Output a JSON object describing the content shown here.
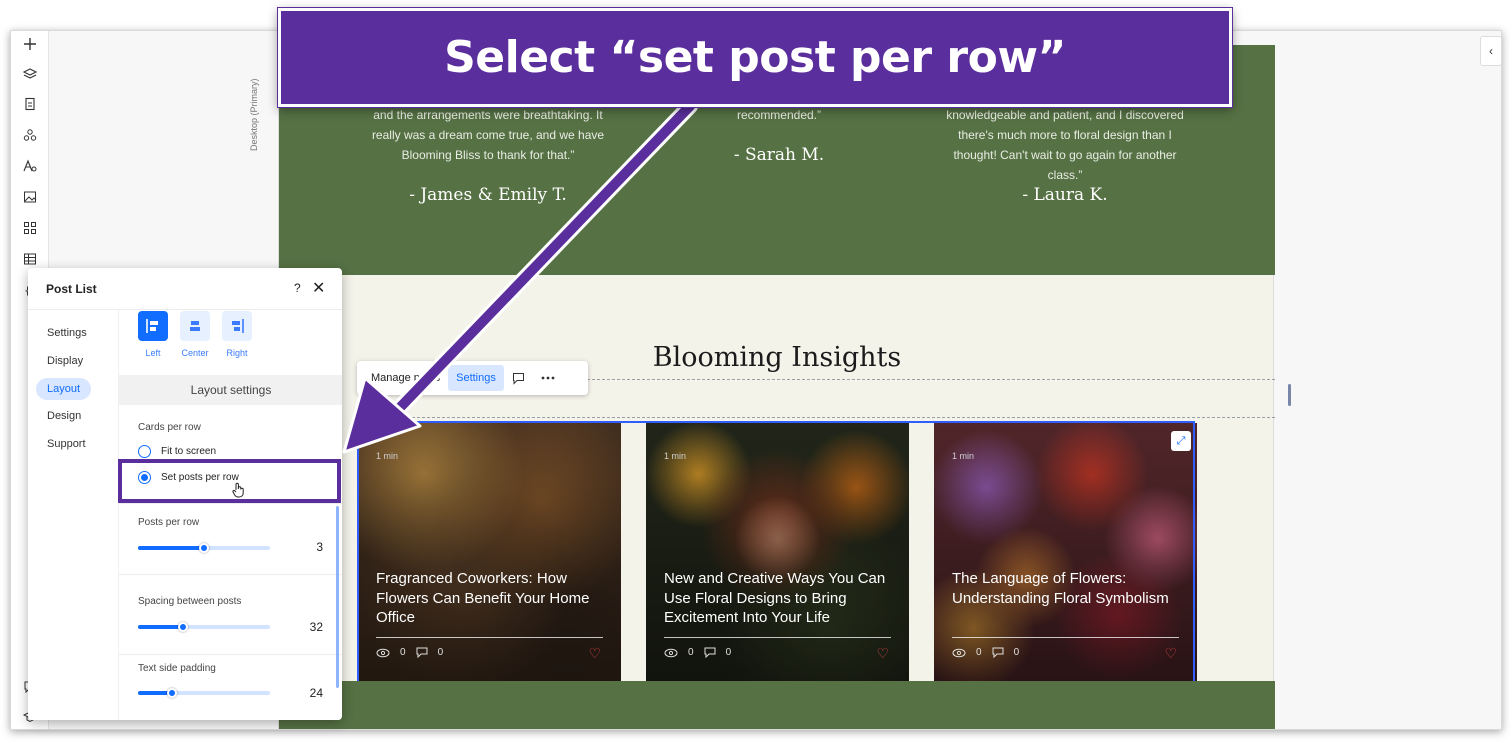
{
  "callout": {
    "text": "Select “set post per row”"
  },
  "canvas": {
    "desktop_label": "Desktop (Primary)",
    "testimonials": [
      {
        "text": "and the arrangements were breathtaking. It really was a dream come true, and we have Blooming Bliss to thank for that.”",
        "author": "- James & Emily T."
      },
      {
        "text": "recommended.”",
        "author": "- Sarah M."
      },
      {
        "text": "knowledgeable and patient, and I discovered there's much more to floral design than I thought! Can't wait to go again for another class.”",
        "author": "- Laura K."
      }
    ],
    "section_title": "Blooming Insights"
  },
  "element_toolbar": {
    "manage_label": "Manage posts",
    "settings_label": "Settings"
  },
  "posts": [
    {
      "read_time": "1 min",
      "title": "Fragranced Coworkers: How Flowers Can Benefit Your Home Office",
      "views": "0",
      "comments": "0"
    },
    {
      "read_time": "1 min",
      "title": "New and Creative Ways You Can Use Floral Designs to Bring Excitement Into Your Life",
      "views": "0",
      "comments": "0"
    },
    {
      "read_time": "1 min",
      "title": "The Language of Flowers: Understanding Floral Symbolism",
      "views": "0",
      "comments": "0"
    }
  ],
  "panel": {
    "title": "Post List",
    "help": "?",
    "nav": [
      "Settings",
      "Display",
      "Layout",
      "Design",
      "Support"
    ],
    "active_nav": "Layout",
    "alignment": {
      "left": "Left",
      "center": "Center",
      "right": "Right",
      "selected": "Left"
    },
    "section": "Layout settings",
    "cards_per_row": {
      "label": "Cards per row",
      "options": [
        "Fit to screen",
        "Set posts per row"
      ],
      "selected": "Set posts per row"
    },
    "posts_per_row": {
      "label": "Posts per row",
      "value": "3",
      "fraction": 0.5
    },
    "spacing": {
      "label": "Spacing between posts",
      "value": "32",
      "fraction": 0.34
    },
    "padding": {
      "label": "Text side padding",
      "value": "24",
      "fraction": 0.26
    }
  },
  "colors": {
    "accent": "#116dff",
    "callout": "#5a2e9c",
    "site_green": "#567144",
    "heart": "#e0454f"
  }
}
